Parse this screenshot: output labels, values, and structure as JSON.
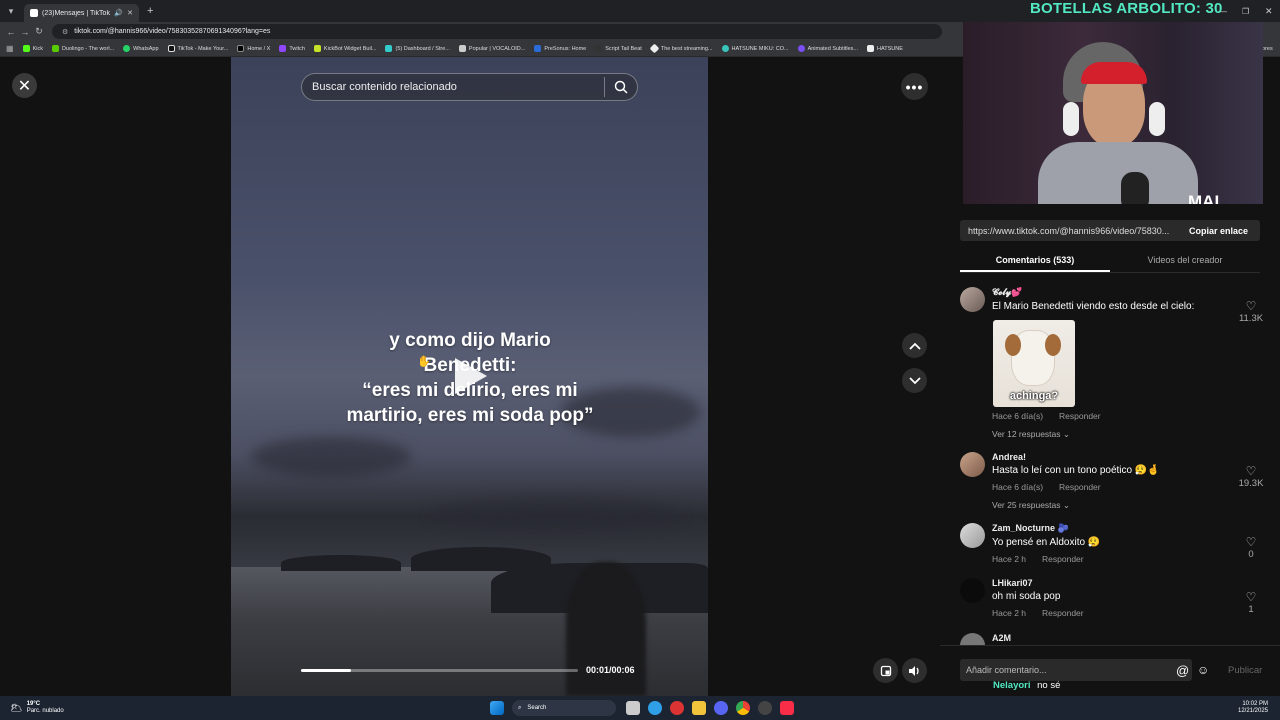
{
  "browser": {
    "tab_title": "(23)Mensajes | TikTok",
    "url": "tiktok.com/@hannis966/video/7583035287069134096?lang=es",
    "bookmarks": [
      "Kick",
      "Duolingo - The worl...",
      "WhatsApp",
      "TikTok - Make Your...",
      "Home / X",
      "Twitch",
      "KickBot Widget Buil...",
      "(5) Dashboard / Stre...",
      "Popular | VOCALOID...",
      "PreSonus: Home",
      "Script Tail Beat",
      "The best streaming...",
      "HATSUNE MIKU: CO...",
      "Animated Subtitles...",
      "HATSUNE"
    ],
    "bookmarks_more": "ores"
  },
  "overlay": {
    "goal_text": "BOTELLAS ARBOLITO: 30",
    "brand": "MAI"
  },
  "video": {
    "search_placeholder": "Buscar contenido relacionado",
    "caption_lines": [
      "y como dijo Mario",
      "Benedetti:",
      "“eres mi delirio, eres mi",
      "martirio, eres mi soda pop”"
    ],
    "time": "00:01/00:06",
    "progress": 0.18
  },
  "panel": {
    "url": "https://www.tiktok.com/@hannis966/video/75830...",
    "copy_label": "Copiar enlace",
    "tabs": [
      "Comentarios (533)",
      "Videos del creador"
    ],
    "comments": [
      {
        "user": "𝓒𝓮𝓵𝔂💕",
        "text": "El Mario Benedetti viendo esto desde el cielo:",
        "meta": "Hace 6 día(s)",
        "reply": "Responder",
        "replies": "Ver 12 respuestas",
        "likes": "11.3K"
      },
      {
        "user": "Andrea!",
        "text": "Hasta lo leí con un tono poético 😮‍💨🤞",
        "meta": "Hace 6 día(s)",
        "reply": "Responder",
        "replies": "Ver 25 respuestas",
        "likes": "19.3K"
      },
      {
        "user": "Zam_Nocturne 🫐",
        "text": "Yo pensé en Aldoxito 😮‍💨",
        "meta": "Hace 2 h",
        "reply": "Responder",
        "likes": "0"
      },
      {
        "user": "LHikari07",
        "text": "oh mi soda pop",
        "meta": "Hace 2 h",
        "reply": "Responder",
        "likes": "1"
      },
      {
        "user": "A2M"
      }
    ],
    "meme_caption": "achinga?",
    "comment_placeholder": "Añadir comentario...",
    "publish_label": "Publicar",
    "chat_user": "Nelayori",
    "chat_text": "no sé"
  },
  "taskbar": {
    "weather_temp": "19°C",
    "weather_desc": "Parc. nublado",
    "search_label": "Search",
    "time": "10:02 PM",
    "date": "12/21/2025"
  },
  "colors": {
    "goal_accent": "#52e8c2",
    "tiktok_bg": "#121212",
    "taskbar": "#1c2431"
  }
}
